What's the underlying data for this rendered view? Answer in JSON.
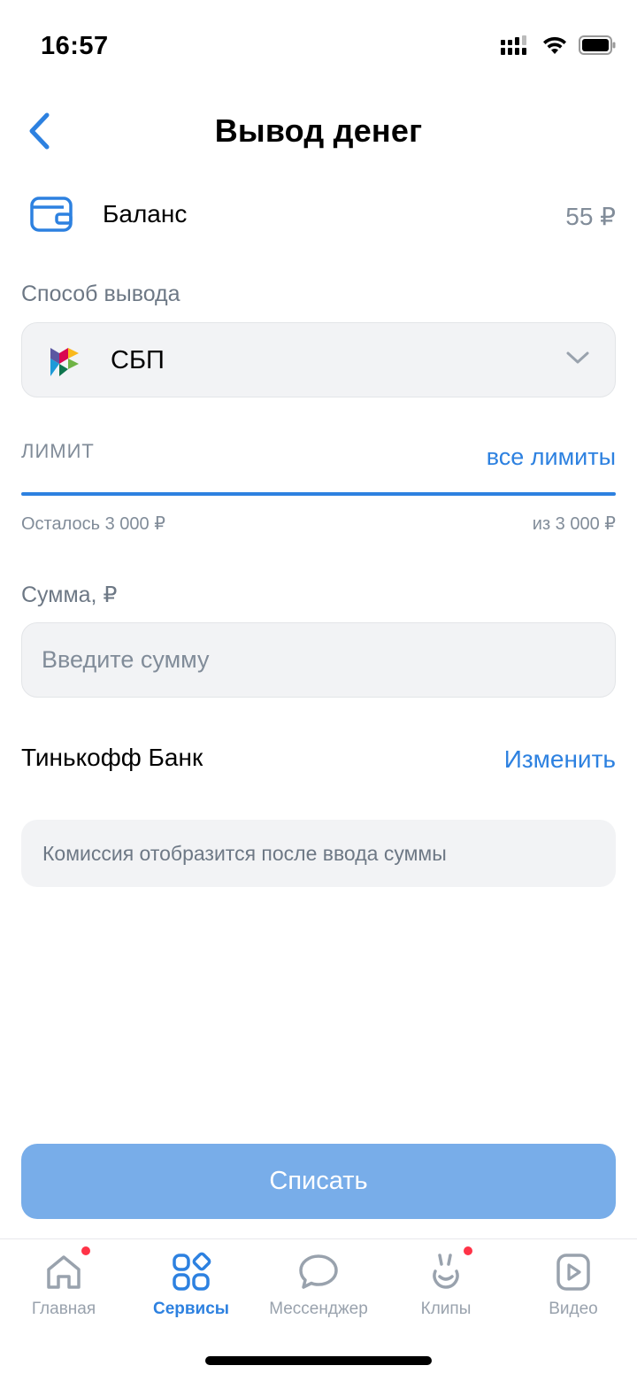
{
  "status": {
    "time": "16:57"
  },
  "header": {
    "title": "Вывод денег"
  },
  "balance": {
    "label": "Баланс",
    "value": "55 ₽"
  },
  "withdrawal_method": {
    "label": "Способ вывода",
    "selected": "СБП"
  },
  "limit": {
    "label": "ЛИМИТ",
    "all_limits_link": "все лимиты",
    "remaining": "Осталось 3 000 ₽",
    "total": "из 3 000 ₽",
    "used_fraction": 0
  },
  "amount": {
    "label": "Сумма, ₽",
    "placeholder": "Введите сумму",
    "value": ""
  },
  "bank": {
    "name": "Тинькофф Банк",
    "change_label": "Изменить"
  },
  "commission": {
    "text": "Комиссия отобразится после ввода суммы"
  },
  "submit": {
    "label": "Списать"
  },
  "tabbar": {
    "items": [
      {
        "label": "Главная",
        "icon": "home-icon",
        "active": false,
        "badge": true
      },
      {
        "label": "Сервисы",
        "icon": "services-icon",
        "active": true,
        "badge": false
      },
      {
        "label": "Мессенджер",
        "icon": "chat-bubble-icon",
        "active": false,
        "badge": false
      },
      {
        "label": "Клипы",
        "icon": "clips-icon",
        "active": false,
        "badge": true
      },
      {
        "label": "Видео",
        "icon": "video-icon",
        "active": false,
        "badge": false
      }
    ]
  },
  "colors": {
    "accent": "#2d81e0",
    "button_disabled": "#78ade9",
    "field_bg": "#f2f3f5",
    "secondary_text": "#818c99",
    "badge": "#ff3347"
  }
}
